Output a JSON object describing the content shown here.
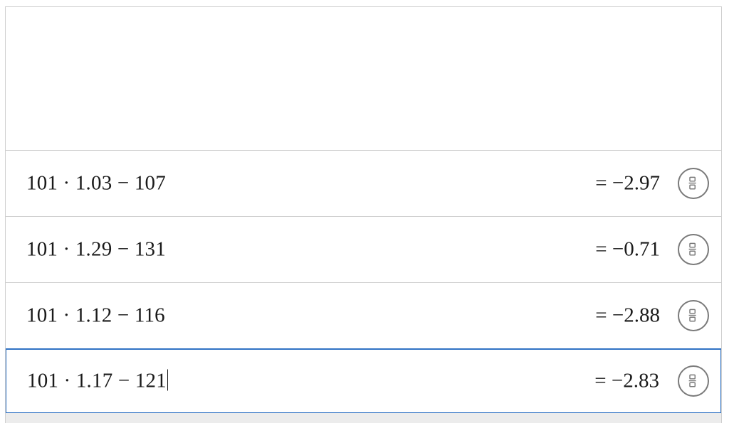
{
  "expressions": [
    {
      "input": "101 · 1.03 − 107",
      "result": "= −2.97",
      "toggle_icon": "fraction-toggle-icon"
    },
    {
      "input": "101 · 1.29 − 131",
      "result": "= −0.71",
      "toggle_icon": "fraction-toggle-icon"
    },
    {
      "input": "101 · 1.12 − 116",
      "result": "= −2.88",
      "toggle_icon": "fraction-toggle-icon"
    },
    {
      "input": "101 · 1.17 − 121",
      "result": "= −2.83",
      "toggle_icon": "fraction-toggle-icon"
    }
  ],
  "active_row": 3,
  "colors": {
    "active_border": "#2f72c4",
    "row_divider": "#cfcfcf",
    "icon_stroke": "#7a7a7a",
    "bottom_strip": "#ececec"
  }
}
